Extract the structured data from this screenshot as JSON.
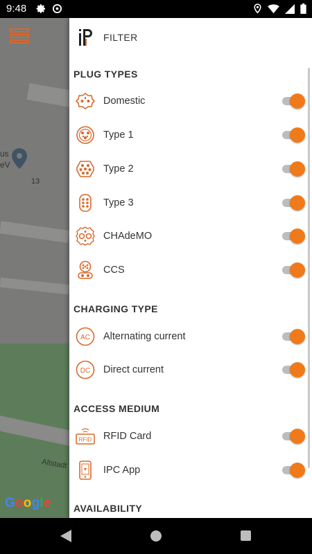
{
  "status_bar": {
    "time": "9:48"
  },
  "map": {
    "poi_fragment": "us\neV",
    "street_number": "13",
    "street_fragment": "Altstadt",
    "google_letters": [
      "G",
      "o",
      "o",
      "g",
      "l",
      "e"
    ]
  },
  "drawer": {
    "title": "FILTER",
    "sections": {
      "plug_types": {
        "title": "PLUG TYPES",
        "items": [
          {
            "label": "Domestic",
            "icon": "domestic-plug-icon",
            "enabled": true
          },
          {
            "label": "Type 1",
            "icon": "type1-plug-icon",
            "enabled": true
          },
          {
            "label": "Type 2",
            "icon": "type2-plug-icon",
            "enabled": true
          },
          {
            "label": "Type 3",
            "icon": "type3-plug-icon",
            "enabled": true
          },
          {
            "label": "CHAdeMO",
            "icon": "chademo-plug-icon",
            "enabled": true
          },
          {
            "label": "CCS",
            "icon": "ccs-plug-icon",
            "enabled": true
          }
        ]
      },
      "charging_type": {
        "title": "CHARGING TYPE",
        "items": [
          {
            "label": "Alternating current",
            "badge": "AC",
            "icon": "ac-icon",
            "enabled": true
          },
          {
            "label": "Direct current",
            "badge": "DC",
            "icon": "dc-icon",
            "enabled": true
          }
        ]
      },
      "access_medium": {
        "title": "ACCESS MEDIUM",
        "items": [
          {
            "label": "RFID Card",
            "badge": "RFID",
            "icon": "rfid-card-icon",
            "enabled": true
          },
          {
            "label": "IPC App",
            "icon": "phone-app-icon",
            "enabled": true
          }
        ]
      },
      "availability": {
        "title": "AVAILABILITY"
      }
    }
  },
  "colors": {
    "accent": "#f07a1a",
    "icon_orange": "#d8682b",
    "track": "#bdbdbd",
    "text": "#333333"
  }
}
